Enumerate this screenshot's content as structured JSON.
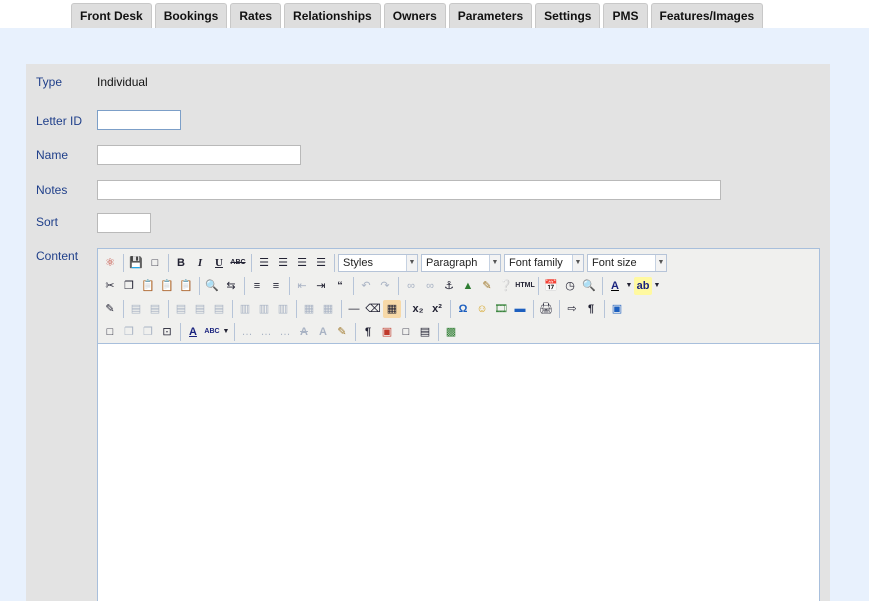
{
  "tabs": [
    "Front Desk",
    "Bookings",
    "Rates",
    "Relationships",
    "Owners",
    "Parameters",
    "Settings",
    "PMS",
    "Features/Images"
  ],
  "form": {
    "type_label": "Type",
    "type_value": "Individual",
    "letter_id_label": "Letter ID",
    "letter_id_value": "",
    "name_label": "Name",
    "name_value": "",
    "notes_label": "Notes",
    "notes_value": "",
    "sort_label": "Sort",
    "sort_value": "",
    "content_label": "Content"
  },
  "editor": {
    "styles": "Styles",
    "paragraph": "Paragraph",
    "font_family": "Font family",
    "font_size": "Font size",
    "bold": "B",
    "italic": "I",
    "underline": "U",
    "strike": "ABC",
    "html": "HTML",
    "subscript": "x₂",
    "superscript": "x²",
    "omega": "Ω",
    "pilcrow": "¶",
    "font_color": "A",
    "highlight": "ab",
    "abc_check": "ABC",
    "quote": "“",
    "styleprops": "A",
    "styleprops2": "A"
  },
  "colors": {
    "background": "#e8f1fd",
    "panel": "#e3e3e3",
    "label": "#1f3f8a",
    "tab": "#dedede"
  }
}
